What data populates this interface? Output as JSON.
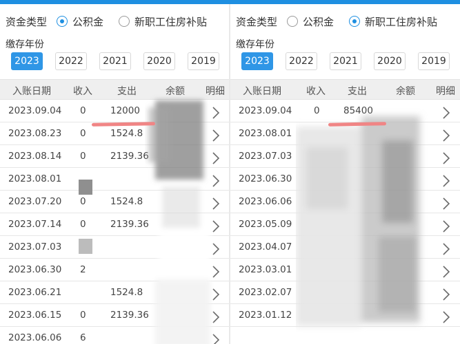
{
  "left": {
    "fund_type_label": "资金类型",
    "options": [
      {
        "label": "公积金",
        "checked": true
      },
      {
        "label": "新职工住房补贴",
        "checked": false
      }
    ],
    "year_label": "缴存年份",
    "years": [
      "2023",
      "2022",
      "2021",
      "2020",
      "2019"
    ],
    "active_year": "2023",
    "columns": [
      "入账日期",
      "收入",
      "支出",
      "余额",
      "明细"
    ],
    "rows": [
      {
        "date": "2023.09.04",
        "income": "0",
        "expense": "12000"
      },
      {
        "date": "2023.08.23",
        "income": "0",
        "expense": "1524.8"
      },
      {
        "date": "2023.08.14",
        "income": "0",
        "expense": "2139.36"
      },
      {
        "date": "2023.08.01",
        "income": "",
        "expense": ""
      },
      {
        "date": "2023.07.20",
        "income": "0",
        "expense": "1524.8"
      },
      {
        "date": "2023.07.14",
        "income": "0",
        "expense": "2139.36"
      },
      {
        "date": "2023.07.03",
        "income": "",
        "expense": ""
      },
      {
        "date": "2023.06.30",
        "income": "2",
        "expense": ""
      },
      {
        "date": "2023.06.21",
        "income": "",
        "expense": "1524.8"
      },
      {
        "date": "2023.06.15",
        "income": "0",
        "expense": "2139.36"
      },
      {
        "date": "2023.06.06",
        "income": "6",
        "expense": ""
      }
    ]
  },
  "right": {
    "fund_type_label": "资金类型",
    "options": [
      {
        "label": "公积金",
        "checked": false
      },
      {
        "label": "新职工住房补贴",
        "checked": true
      }
    ],
    "year_label": "缴存年份",
    "years": [
      "2023",
      "2022",
      "2021",
      "2020",
      "2019"
    ],
    "active_year": "2023",
    "columns": [
      "入账日期",
      "收入",
      "支出",
      "余额",
      "明细"
    ],
    "rows": [
      {
        "date": "2023.09.04",
        "income": "0",
        "expense": "85400"
      },
      {
        "date": "2023.08.01",
        "income": "",
        "expense": ""
      },
      {
        "date": "2023.07.03",
        "income": "",
        "expense": ""
      },
      {
        "date": "2023.06.30",
        "income": "",
        "expense": ""
      },
      {
        "date": "2023.06.06",
        "income": "",
        "expense": ""
      },
      {
        "date": "2023.05.09",
        "income": "",
        "expense": ""
      },
      {
        "date": "2023.04.07",
        "income": "",
        "expense": ""
      },
      {
        "date": "2023.03.01",
        "income": "",
        "expense": ""
      },
      {
        "date": "2023.02.07",
        "income": "",
        "expense": ""
      },
      {
        "date": "2023.01.12",
        "income": "",
        "expense": ""
      }
    ]
  },
  "icons": {
    "radio": "radio-button-icon",
    "chevron": "chevron-right-icon"
  },
  "colors": {
    "accent": "#1e8fe1",
    "active_year_bg": "#2f96e6",
    "highlight": "#f08585"
  }
}
